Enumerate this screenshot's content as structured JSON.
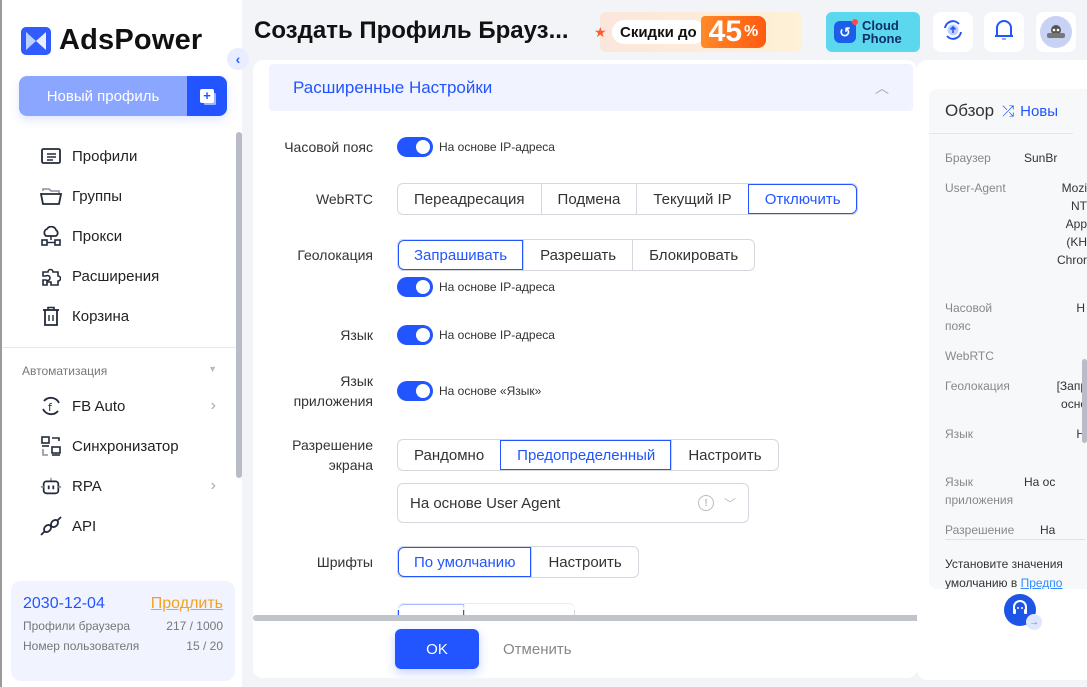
{
  "app": {
    "name": "AdsPower",
    "page_title": "Создать Профиль Брауз..."
  },
  "sidebar": {
    "new_profile_label": "Новый профиль",
    "items": [
      {
        "label": "Профили",
        "icon": "profiles-icon"
      },
      {
        "label": "Группы",
        "icon": "folder-icon"
      },
      {
        "label": "Прокси",
        "icon": "proxy-icon"
      },
      {
        "label": "Расширения",
        "icon": "puzzle-icon"
      },
      {
        "label": "Корзина",
        "icon": "trash-icon"
      }
    ],
    "automation_title": "Автоматизация",
    "automation_items": [
      {
        "label": "FB Auto",
        "icon": "facebook-sync-icon",
        "has_submenu": true
      },
      {
        "label": "Синхронизатор",
        "icon": "synchronizer-icon",
        "has_submenu": false
      },
      {
        "label": "RPA",
        "icon": "robot-icon",
        "has_submenu": true
      },
      {
        "label": "API",
        "icon": "plug-icon",
        "has_submenu": false
      }
    ],
    "plan": {
      "expiry_date": "2030-12-04",
      "renew_label": "Продлить",
      "rows": [
        {
          "label": "Профили браузера",
          "value": "217 / 1000"
        },
        {
          "label": "Номер пользователя",
          "value": "15 / 20"
        }
      ]
    }
  },
  "header": {
    "promo_text": "Скидки до",
    "promo_percent": "45",
    "promo_suffix": "%",
    "cloud_phone_line1": "Cloud",
    "cloud_phone_line2": "Phone"
  },
  "advanced": {
    "title": "Расширенные Настройки",
    "timezone": {
      "label": "Часовой пояс",
      "toggle_on": true,
      "toggle_label": "На основе IP-адреса"
    },
    "webrtc": {
      "label": "WebRTC",
      "options": [
        "Переадресация",
        "Подмена",
        "Текущий IP",
        "Отключить"
      ],
      "selected": "Отключить"
    },
    "geolocation": {
      "label": "Геолокация",
      "options": [
        "Запрашивать",
        "Разрешать",
        "Блокировать"
      ],
      "selected": "Запрашивать",
      "toggle_on": true,
      "toggle_label": "На основе IP-адреса"
    },
    "language": {
      "label": "Язык",
      "toggle_on": true,
      "toggle_label": "На основе IP-адреса"
    },
    "app_language": {
      "label_line1": "Язык",
      "label_line2": "приложения",
      "toggle_on": true,
      "toggle_label": "На основе «Язык»"
    },
    "resolution": {
      "label_line1": "Разрешение",
      "label_line2": "экрана",
      "options": [
        "Рандомно",
        "Предопределенный",
        "Настроить"
      ],
      "selected": "Предопределенный",
      "select_value": "На основе User Agent"
    },
    "fonts": {
      "label": "Шрифты",
      "options": [
        "По умолчанию",
        "Настроить"
      ],
      "selected": "По умолчанию"
    }
  },
  "footer": {
    "ok_label": "OK",
    "cancel_label": "Отменить"
  },
  "overview": {
    "title": "Обзор",
    "new_label": "Новы",
    "rows": [
      {
        "label": "Браузер",
        "value": "SunBr"
      },
      {
        "label": "User-Agent",
        "value_lines": [
          "Mozi",
          "NT",
          "App",
          "(KH",
          "Chror"
        ]
      },
      {
        "label_lines": [
          "Часовой",
          "пояс"
        ],
        "value": "Н"
      },
      {
        "label": "WebRTC",
        "value": ""
      },
      {
        "label": "Геолокация",
        "value_lines": [
          "[Запр",
          "осно"
        ]
      },
      {
        "label": "Язык",
        "value": "Н"
      },
      {
        "label_lines": [
          "Язык",
          "приложения"
        ],
        "value": "На ос"
      },
      {
        "label": "Разрешение",
        "value": "На"
      }
    ],
    "note_line1": "Установите значения",
    "note_line2_prefix": "умолчанию в ",
    "note_link": "Предпо"
  }
}
